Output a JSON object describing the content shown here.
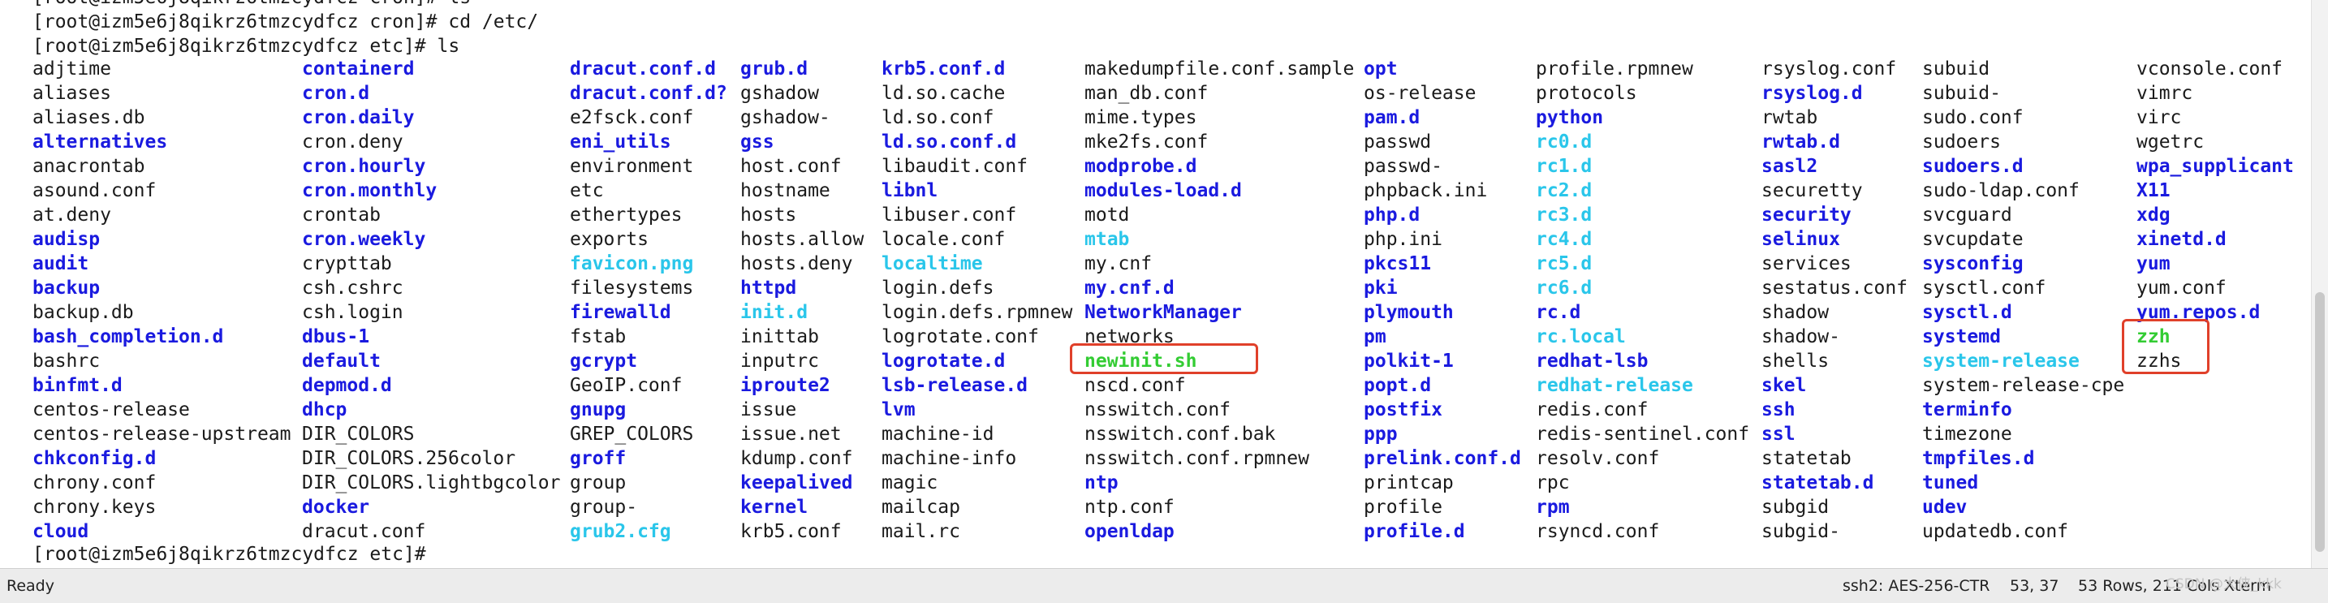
{
  "terminal": {
    "partial_line": "[root@izm5e6j8qikrz6tmzcydfcz cron]# ls",
    "cmd_line1": "[root@izm5e6j8qikrz6tmzcydfcz cron]# cd /etc/",
    "cmd_line2": "[root@izm5e6j8qikrz6tmzcydfcz etc]# ls",
    "prompt_last": "[root@izm5e6j8qikrz6tmzcydfcz etc]# ",
    "colors": {
      "directory": "#1a1adf",
      "symlink": "#2ac6ea",
      "executable": "#33cc33",
      "highlight": "#e0402a"
    },
    "columns": [
      [
        [
          "adjtime",
          "f"
        ],
        [
          "aliases",
          "f"
        ],
        [
          "aliases.db",
          "f"
        ],
        [
          "alternatives",
          "d"
        ],
        [
          "anacrontab",
          "f"
        ],
        [
          "asound.conf",
          "f"
        ],
        [
          "at.deny",
          "f"
        ],
        [
          "audisp",
          "d"
        ],
        [
          "audit",
          "d"
        ],
        [
          "backup",
          "d"
        ],
        [
          "backup.db",
          "f"
        ],
        [
          "bash_completion.d",
          "d"
        ],
        [
          "bashrc",
          "f"
        ],
        [
          "binfmt.d",
          "d"
        ],
        [
          "centos-release",
          "f"
        ],
        [
          "centos-release-upstream",
          "f"
        ],
        [
          "chkconfig.d",
          "d"
        ],
        [
          "chrony.conf",
          "f"
        ],
        [
          "chrony.keys",
          "f"
        ],
        [
          "cloud",
          "d"
        ]
      ],
      [
        [
          "containerd",
          "d"
        ],
        [
          "cron.d",
          "d"
        ],
        [
          "cron.daily",
          "d"
        ],
        [
          "cron.deny",
          "f"
        ],
        [
          "cron.hourly",
          "d"
        ],
        [
          "cron.monthly",
          "d"
        ],
        [
          "crontab",
          "f"
        ],
        [
          "cron.weekly",
          "d"
        ],
        [
          "crypttab",
          "f"
        ],
        [
          "csh.cshrc",
          "f"
        ],
        [
          "csh.login",
          "f"
        ],
        [
          "dbus-1",
          "d"
        ],
        [
          "default",
          "d"
        ],
        [
          "depmod.d",
          "d"
        ],
        [
          "dhcp",
          "d"
        ],
        [
          "DIR_COLORS",
          "f"
        ],
        [
          "DIR_COLORS.256color",
          "f"
        ],
        [
          "DIR_COLORS.lightbgcolor",
          "f"
        ],
        [
          "docker",
          "d"
        ],
        [
          "dracut.conf",
          "f"
        ]
      ],
      [
        [
          "dracut.conf.d",
          "d"
        ],
        [
          "dracut.conf.d?",
          "d"
        ],
        [
          "e2fsck.conf",
          "f"
        ],
        [
          "eni_utils",
          "d"
        ],
        [
          "environment",
          "f"
        ],
        [
          "etc",
          "f"
        ],
        [
          "ethertypes",
          "f"
        ],
        [
          "exports",
          "f"
        ],
        [
          "favicon.png",
          "l"
        ],
        [
          "filesystems",
          "f"
        ],
        [
          "firewalld",
          "d"
        ],
        [
          "fstab",
          "f"
        ],
        [
          "gcrypt",
          "d"
        ],
        [
          "GeoIP.conf",
          "f"
        ],
        [
          "gnupg",
          "d"
        ],
        [
          "GREP_COLORS",
          "f"
        ],
        [
          "groff",
          "d"
        ],
        [
          "group",
          "f"
        ],
        [
          "group-",
          "f"
        ],
        [
          "grub2.cfg",
          "l"
        ]
      ],
      [
        [
          "grub.d",
          "d"
        ],
        [
          "gshadow",
          "f"
        ],
        [
          "gshadow-",
          "f"
        ],
        [
          "gss",
          "d"
        ],
        [
          "host.conf",
          "f"
        ],
        [
          "hostname",
          "f"
        ],
        [
          "hosts",
          "f"
        ],
        [
          "hosts.allow",
          "f"
        ],
        [
          "hosts.deny",
          "f"
        ],
        [
          "httpd",
          "d"
        ],
        [
          "init.d",
          "l"
        ],
        [
          "inittab",
          "f"
        ],
        [
          "inputrc",
          "f"
        ],
        [
          "iproute2",
          "d"
        ],
        [
          "issue",
          "f"
        ],
        [
          "issue.net",
          "f"
        ],
        [
          "kdump.conf",
          "f"
        ],
        [
          "keepalived",
          "d"
        ],
        [
          "kernel",
          "d"
        ],
        [
          "krb5.conf",
          "f"
        ]
      ],
      [
        [
          "krb5.conf.d",
          "d"
        ],
        [
          "ld.so.cache",
          "f"
        ],
        [
          "ld.so.conf",
          "f"
        ],
        [
          "ld.so.conf.d",
          "d"
        ],
        [
          "libaudit.conf",
          "f"
        ],
        [
          "libnl",
          "d"
        ],
        [
          "libuser.conf",
          "f"
        ],
        [
          "locale.conf",
          "f"
        ],
        [
          "localtime",
          "l"
        ],
        [
          "login.defs",
          "f"
        ],
        [
          "login.defs.rpmnew",
          "f"
        ],
        [
          "logrotate.conf",
          "f"
        ],
        [
          "logrotate.d",
          "d"
        ],
        [
          "lsb-release.d",
          "d"
        ],
        [
          "lvm",
          "d"
        ],
        [
          "machine-id",
          "f"
        ],
        [
          "machine-info",
          "f"
        ],
        [
          "magic",
          "f"
        ],
        [
          "mailcap",
          "f"
        ],
        [
          "mail.rc",
          "f"
        ]
      ],
      [
        [
          "makedumpfile.conf.sample",
          "f"
        ],
        [
          "man_db.conf",
          "f"
        ],
        [
          "mime.types",
          "f"
        ],
        [
          "mke2fs.conf",
          "f"
        ],
        [
          "modprobe.d",
          "d"
        ],
        [
          "modules-load.d",
          "d"
        ],
        [
          "motd",
          "f"
        ],
        [
          "mtab",
          "l"
        ],
        [
          "my.cnf",
          "f"
        ],
        [
          "my.cnf.d",
          "d"
        ],
        [
          "NetworkManager",
          "d"
        ],
        [
          "networks",
          "f"
        ],
        [
          "newinit.sh",
          "x"
        ],
        [
          "nscd.conf",
          "f"
        ],
        [
          "nsswitch.conf",
          "f"
        ],
        [
          "nsswitch.conf.bak",
          "f"
        ],
        [
          "nsswitch.conf.rpmnew",
          "f"
        ],
        [
          "ntp",
          "d"
        ],
        [
          "ntp.conf",
          "f"
        ],
        [
          "openldap",
          "d"
        ]
      ],
      [
        [
          "opt",
          "d"
        ],
        [
          "os-release",
          "f"
        ],
        [
          "pam.d",
          "d"
        ],
        [
          "passwd",
          "f"
        ],
        [
          "passwd-",
          "f"
        ],
        [
          "phpback.ini",
          "f"
        ],
        [
          "php.d",
          "d"
        ],
        [
          "php.ini",
          "f"
        ],
        [
          "pkcs11",
          "d"
        ],
        [
          "pki",
          "d"
        ],
        [
          "plymouth",
          "d"
        ],
        [
          "pm",
          "d"
        ],
        [
          "polkit-1",
          "d"
        ],
        [
          "popt.d",
          "d"
        ],
        [
          "postfix",
          "d"
        ],
        [
          "ppp",
          "d"
        ],
        [
          "prelink.conf.d",
          "d"
        ],
        [
          "printcap",
          "f"
        ],
        [
          "profile",
          "f"
        ],
        [
          "profile.d",
          "d"
        ]
      ],
      [
        [
          "profile.rpmnew",
          "f"
        ],
        [
          "protocols",
          "f"
        ],
        [
          "python",
          "d"
        ],
        [
          "rc0.d",
          "l"
        ],
        [
          "rc1.d",
          "l"
        ],
        [
          "rc2.d",
          "l"
        ],
        [
          "rc3.d",
          "l"
        ],
        [
          "rc4.d",
          "l"
        ],
        [
          "rc5.d",
          "l"
        ],
        [
          "rc6.d",
          "l"
        ],
        [
          "rc.d",
          "d"
        ],
        [
          "rc.local",
          "l"
        ],
        [
          "redhat-lsb",
          "d"
        ],
        [
          "redhat-release",
          "l"
        ],
        [
          "redis.conf",
          "f"
        ],
        [
          "redis-sentinel.conf",
          "f"
        ],
        [
          "resolv.conf",
          "f"
        ],
        [
          "rpc",
          "f"
        ],
        [
          "rpm",
          "d"
        ],
        [
          "rsyncd.conf",
          "f"
        ]
      ],
      [
        [
          "rsyslog.conf",
          "f"
        ],
        [
          "rsyslog.d",
          "d"
        ],
        [
          "rwtab",
          "f"
        ],
        [
          "rwtab.d",
          "d"
        ],
        [
          "sasl2",
          "d"
        ],
        [
          "securetty",
          "f"
        ],
        [
          "security",
          "d"
        ],
        [
          "selinux",
          "d"
        ],
        [
          "services",
          "f"
        ],
        [
          "sestatus.conf",
          "f"
        ],
        [
          "shadow",
          "f"
        ],
        [
          "shadow-",
          "f"
        ],
        [
          "shells",
          "f"
        ],
        [
          "skel",
          "d"
        ],
        [
          "ssh",
          "d"
        ],
        [
          "ssl",
          "d"
        ],
        [
          "statetab",
          "f"
        ],
        [
          "statetab.d",
          "d"
        ],
        [
          "subgid",
          "f"
        ],
        [
          "subgid-",
          "f"
        ]
      ],
      [
        [
          "subuid",
          "f"
        ],
        [
          "subuid-",
          "f"
        ],
        [
          "sudo.conf",
          "f"
        ],
        [
          "sudoers",
          "f"
        ],
        [
          "sudoers.d",
          "d"
        ],
        [
          "sudo-ldap.conf",
          "f"
        ],
        [
          "svcguard",
          "f"
        ],
        [
          "svcupdate",
          "f"
        ],
        [
          "sysconfig",
          "d"
        ],
        [
          "sysctl.conf",
          "f"
        ],
        [
          "sysctl.d",
          "d"
        ],
        [
          "systemd",
          "d"
        ],
        [
          "system-release",
          "l"
        ],
        [
          "system-release-cpe",
          "f"
        ],
        [
          "terminfo",
          "d"
        ],
        [
          "timezone",
          "f"
        ],
        [
          "tmpfiles.d",
          "d"
        ],
        [
          "tuned",
          "d"
        ],
        [
          "udev",
          "d"
        ],
        [
          "updatedb.conf",
          "f"
        ]
      ],
      [
        [
          "vconsole.conf",
          "f"
        ],
        [
          "vimrc",
          "f"
        ],
        [
          "virc",
          "f"
        ],
        [
          "wgetrc",
          "f"
        ],
        [
          "wpa_supplicant",
          "d"
        ],
        [
          "X11",
          "d"
        ],
        [
          "xdg",
          "d"
        ],
        [
          "xinetd.d",
          "d"
        ],
        [
          "yum",
          "d"
        ],
        [
          "yum.conf",
          "f"
        ],
        [
          "yum.repos.d",
          "d"
        ],
        [
          "zzh",
          "x"
        ],
        [
          "zzhs",
          "f"
        ]
      ]
    ]
  },
  "statusbar": {
    "ready": "Ready",
    "ssh": "ssh2: AES-256-CTR",
    "cursor": "53, 37",
    "size": "53 Rows, 211 Cols",
    "term": "Xterm",
    "watermark": "CSDN @大侠_kkk"
  }
}
